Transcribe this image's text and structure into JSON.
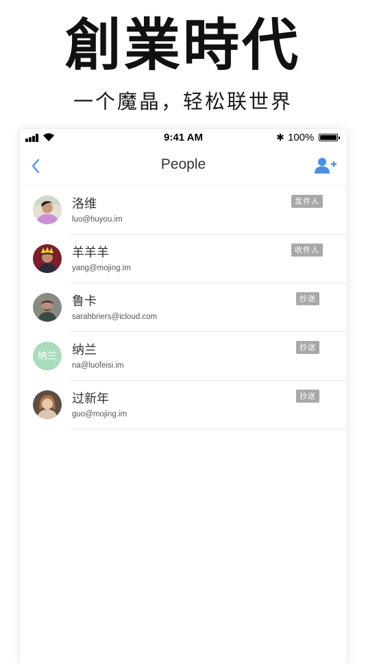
{
  "promo": {
    "title": "創業時代",
    "subtitle": "一个魔晶，轻松联世界"
  },
  "status_bar": {
    "time": "9:41 AM",
    "battery": "100%"
  },
  "nav": {
    "title": "People",
    "back_icon": "chevron-left-icon",
    "add_icon": "add-person-icon",
    "accent_color": "#4a90e2"
  },
  "contacts": [
    {
      "name": "洛维",
      "email": "luo@huyou.im",
      "role": "发件人",
      "avatar": "photo"
    },
    {
      "name": "羊羊羊",
      "email": "yang@mojing.im",
      "role": "收件人",
      "avatar": "photo"
    },
    {
      "name": "鲁卡",
      "email": "sarahbriers@icloud.com",
      "role": "抄送",
      "avatar": "photo"
    },
    {
      "name": "纳兰",
      "email": "na@luofeisi.im",
      "role": "抄送",
      "avatar": "纳兰"
    },
    {
      "name": "过新年",
      "email": "guo@mojing.im",
      "role": "抄送",
      "avatar": "photo"
    }
  ]
}
